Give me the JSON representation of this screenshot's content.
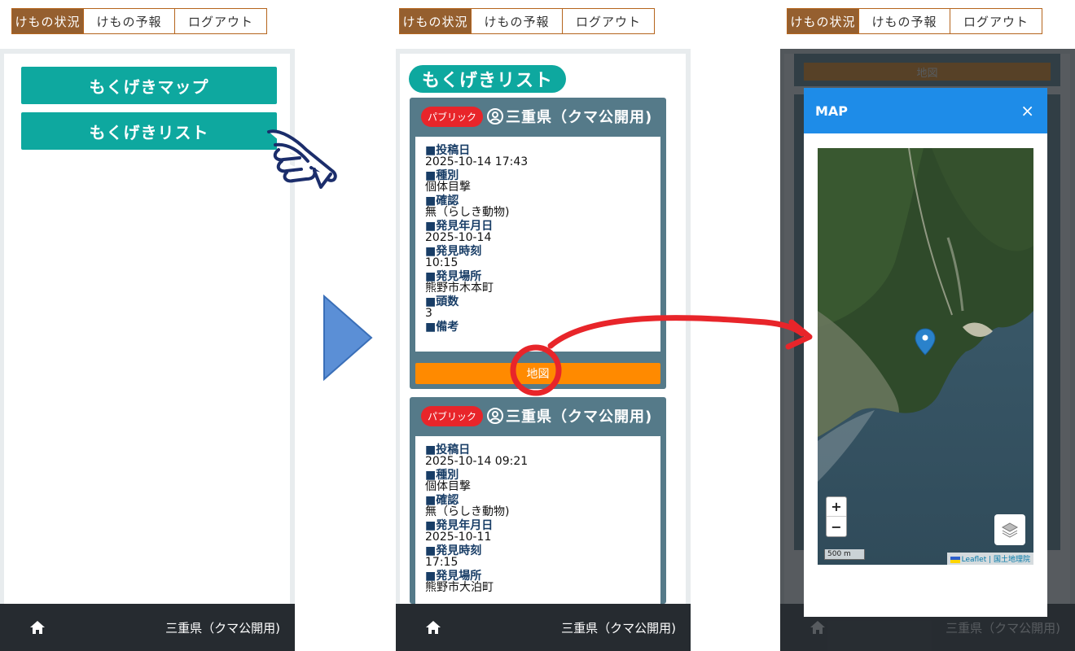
{
  "tabs": [
    {
      "label": "けもの状況"
    },
    {
      "label": "けもの予報"
    },
    {
      "label": "ログアウト"
    }
  ],
  "screen1": {
    "buttons": [
      "もくげきマップ",
      "もくげきリスト"
    ]
  },
  "screen2": {
    "title": "もくげきリスト",
    "cards": [
      {
        "badge": "パブリック",
        "prefecture": "三重県（クマ公開用)",
        "fields": [
          {
            "label": "■投稿日",
            "value": "2025-10-14 17:43"
          },
          {
            "label": "■種別",
            "value": "個体目撃"
          },
          {
            "label": "■確認",
            "value": "無（らしき動物)"
          },
          {
            "label": "■発見年月日",
            "value": "2025-10-14"
          },
          {
            "label": "■発見時刻",
            "value": "10:15"
          },
          {
            "label": "■発見場所",
            "value": "熊野市木本町"
          },
          {
            "label": "■頭数",
            "value": "3"
          },
          {
            "label": "■備考",
            "value": ""
          }
        ],
        "map_button": "地図"
      },
      {
        "badge": "パブリック",
        "prefecture": "三重県（クマ公開用)",
        "fields": [
          {
            "label": "■投稿日",
            "value": "2025-10-14 09:21"
          },
          {
            "label": "■種別",
            "value": "個体目撃"
          },
          {
            "label": "■確認",
            "value": "無（らしき動物)"
          },
          {
            "label": "■発見年月日",
            "value": "2025-10-11"
          },
          {
            "label": "■発見時刻",
            "value": "17:15"
          },
          {
            "label": "■発見場所",
            "value": "熊野市大泊町"
          }
        ]
      }
    ]
  },
  "screen3": {
    "behind_button": "地図",
    "modal_title": "MAP",
    "close_label": "×",
    "zoom_in": "+",
    "zoom_out": "−",
    "scale": "500 m",
    "attribution": "Leaflet | 国土地理院"
  },
  "footer": {
    "prefecture": "三重県（クマ公開用)"
  },
  "colors": {
    "tab_active": "#955f2f",
    "teal": "#0ea89f",
    "card": "#557a89",
    "badge": "#e8252a",
    "map_button": "#ff8a00",
    "modal_header": "#1e8ce8",
    "arrow_red": "#e8252a",
    "triangle_blue": "#5b8fd6"
  }
}
